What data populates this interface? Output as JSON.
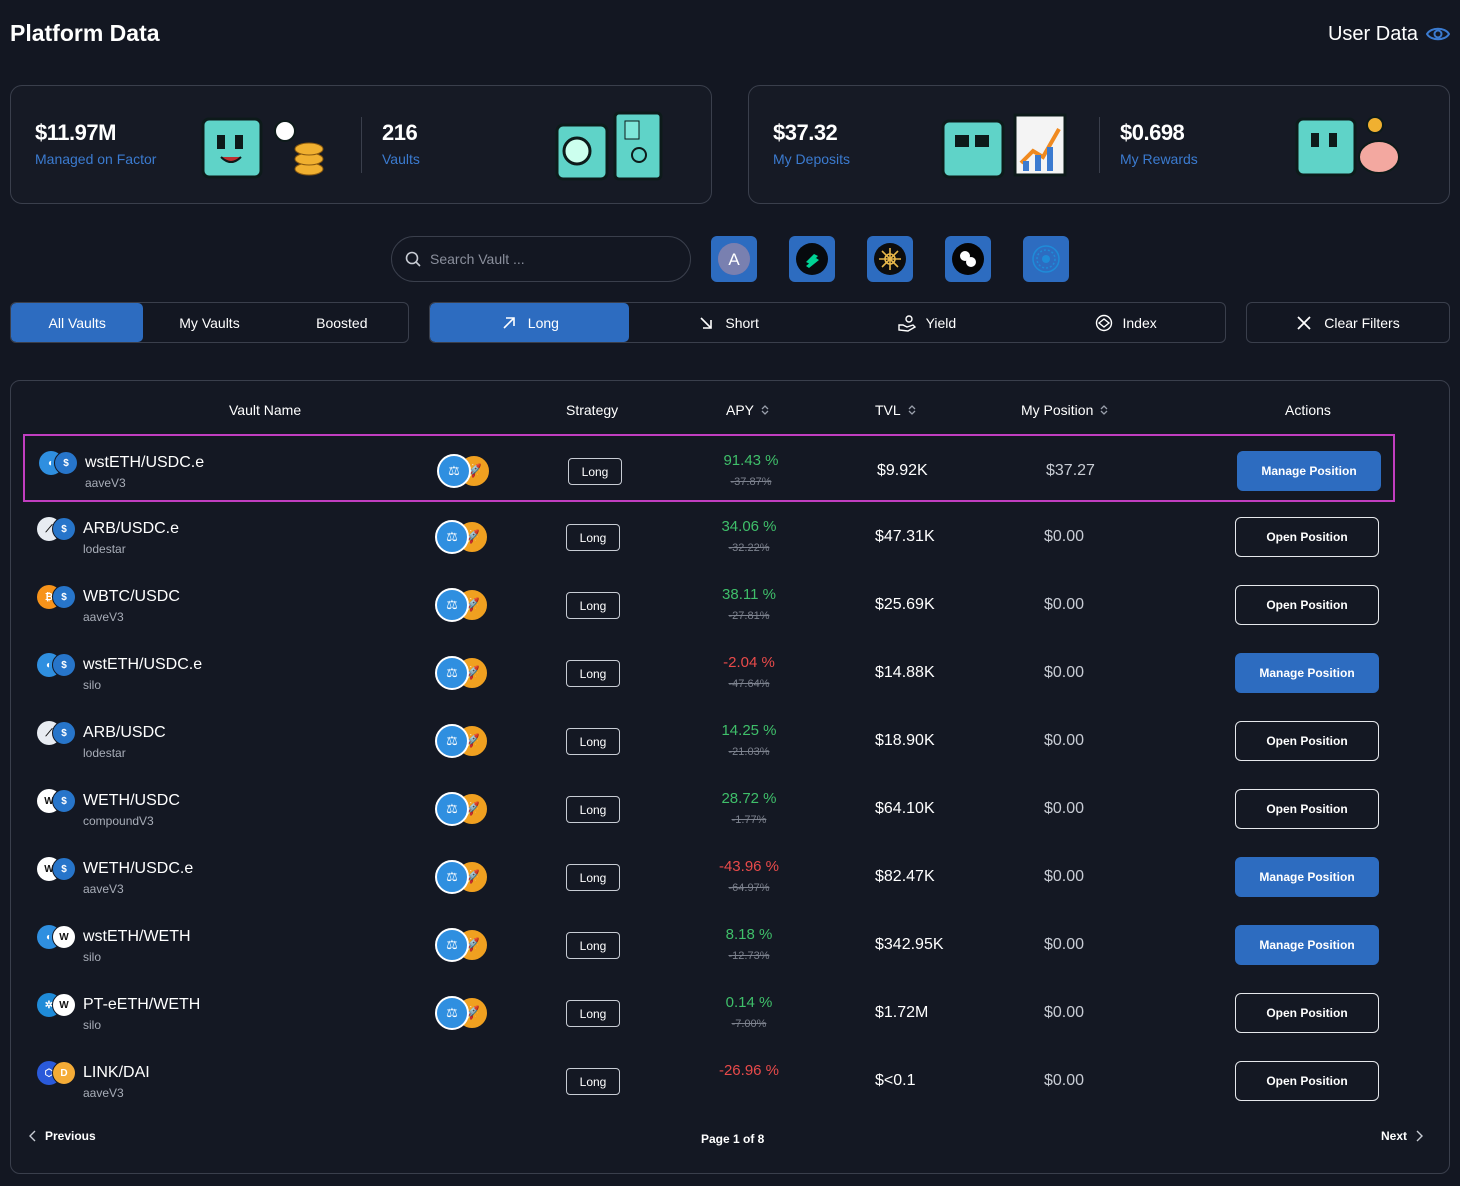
{
  "header": {
    "title": "Platform Data",
    "user_data_label": "User Data"
  },
  "platform_stats": [
    {
      "value": "$11.97M",
      "label": "Managed on Factor"
    },
    {
      "value": "216",
      "label": "Vaults"
    }
  ],
  "user_stats": [
    {
      "value": "$37.32",
      "label": "My Deposits"
    },
    {
      "value": "$0.698",
      "label": "My Rewards"
    }
  ],
  "search": {
    "placeholder": "Search Vault ..."
  },
  "protocol_filters": [
    "aave-logo-icon",
    "compound-logo-icon",
    "lodestar-logo-icon",
    "silo-logo-icon",
    "pendle-logo-icon"
  ],
  "vault_tabs": [
    "All Vaults",
    "My Vaults",
    "Boosted"
  ],
  "strategy_tabs": [
    "Long",
    "Short",
    "Yield",
    "Index"
  ],
  "clear_filters_label": "Clear Filters",
  "columns": {
    "vault_name": "Vault Name",
    "strategy": "Strategy",
    "apy": "APY",
    "tvl": "TVL",
    "my_position": "My Position",
    "actions": "Actions"
  },
  "rows": [
    {
      "name": "wstETH/USDC.e",
      "protocol": "aaveV3",
      "strategy": "Long",
      "apy": "91.43 %",
      "apy_old": "-37.87%",
      "tvl": "$9.92K",
      "position": "$37.27",
      "action": "Manage Position"
    },
    {
      "name": "ARB/USDC.e",
      "protocol": "lodestar",
      "strategy": "Long",
      "apy": "34.06 %",
      "apy_old": "-32.22%",
      "tvl": "$47.31K",
      "position": "$0.00",
      "action": "Open Position"
    },
    {
      "name": "WBTC/USDC",
      "protocol": "aaveV3",
      "strategy": "Long",
      "apy": "38.11 %",
      "apy_old": "-27.81%",
      "tvl": "$25.69K",
      "position": "$0.00",
      "action": "Open Position"
    },
    {
      "name": "wstETH/USDC.e",
      "protocol": "silo",
      "strategy": "Long",
      "apy": "-2.04 %",
      "apy_old": "-47.64%",
      "tvl": "$14.88K",
      "position": "$0.00",
      "action": "Manage Position"
    },
    {
      "name": "ARB/USDC",
      "protocol": "lodestar",
      "strategy": "Long",
      "apy": "14.25 %",
      "apy_old": "-21.03%",
      "tvl": "$18.90K",
      "position": "$0.00",
      "action": "Open Position"
    },
    {
      "name": "WETH/USDC",
      "protocol": "compoundV3",
      "strategy": "Long",
      "apy": "28.72 %",
      "apy_old": "-1.77%",
      "tvl": "$64.10K",
      "position": "$0.00",
      "action": "Open Position"
    },
    {
      "name": "WETH/USDC.e",
      "protocol": "aaveV3",
      "strategy": "Long",
      "apy": "-43.96 %",
      "apy_old": "-64.97%",
      "tvl": "$82.47K",
      "position": "$0.00",
      "action": "Manage Position"
    },
    {
      "name": "wstETH/WETH",
      "protocol": "silo",
      "strategy": "Long",
      "apy": "8.18 %",
      "apy_old": "-12.73%",
      "tvl": "$342.95K",
      "position": "$0.00",
      "action": "Manage Position"
    },
    {
      "name": "PT-eETH/WETH",
      "protocol": "silo",
      "strategy": "Long",
      "apy": "0.14 %",
      "apy_old": "-7.00%",
      "tvl": "$1.72M",
      "position": "$0.00",
      "action": "Open Position"
    },
    {
      "name": "LINK/DAI",
      "protocol": "aaveV3",
      "strategy": "Long",
      "apy": "-26.96 %",
      "apy_old": "",
      "tvl": "$<0.1",
      "position": "$0.00",
      "action": "Open Position"
    }
  ],
  "pagination": {
    "previous": "Previous",
    "page_info": "Page 1 of 8",
    "next": "Next"
  },
  "colors": {
    "accent": "#2d6cc0",
    "positive": "#3fbf6a",
    "negative": "#e84a4a",
    "highlight": "#c13ec0"
  }
}
